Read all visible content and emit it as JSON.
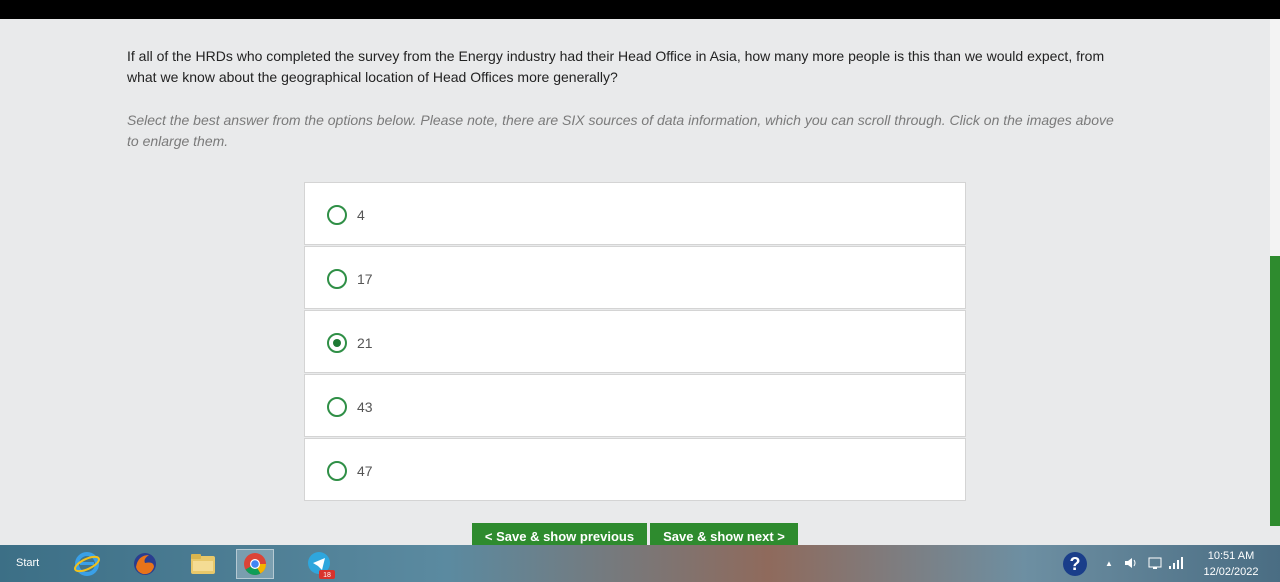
{
  "question": {
    "text": "If all of the HRDs who completed the survey from the Energy industry had their Head Office in Asia, how many more people is this than we would expect, from what we know about the geographical location of Head Offices more generally?",
    "instructions": "Select the best answer from the options below. Please note, there are SIX sources of data information, which you can scroll through. Click on the images above to enlarge them."
  },
  "options": [
    {
      "label": "4",
      "selected": false
    },
    {
      "label": "17",
      "selected": false
    },
    {
      "label": "21",
      "selected": true
    },
    {
      "label": "43",
      "selected": false
    },
    {
      "label": "47",
      "selected": false
    }
  ],
  "buttons": {
    "previous": "< Save & show previous",
    "next": "Save & show next >"
  },
  "taskbar": {
    "start_label": "Start",
    "icons": [
      "internet-explorer-icon",
      "firefox-icon",
      "file-explorer-icon",
      "chrome-icon",
      "telegram-icon"
    ],
    "telegram_badge": "18",
    "clock_time": "10:51 AM",
    "clock_date": "12/02/2022"
  },
  "colors": {
    "accent_green": "#2e8b2e",
    "radio_green": "#2f8f46"
  }
}
